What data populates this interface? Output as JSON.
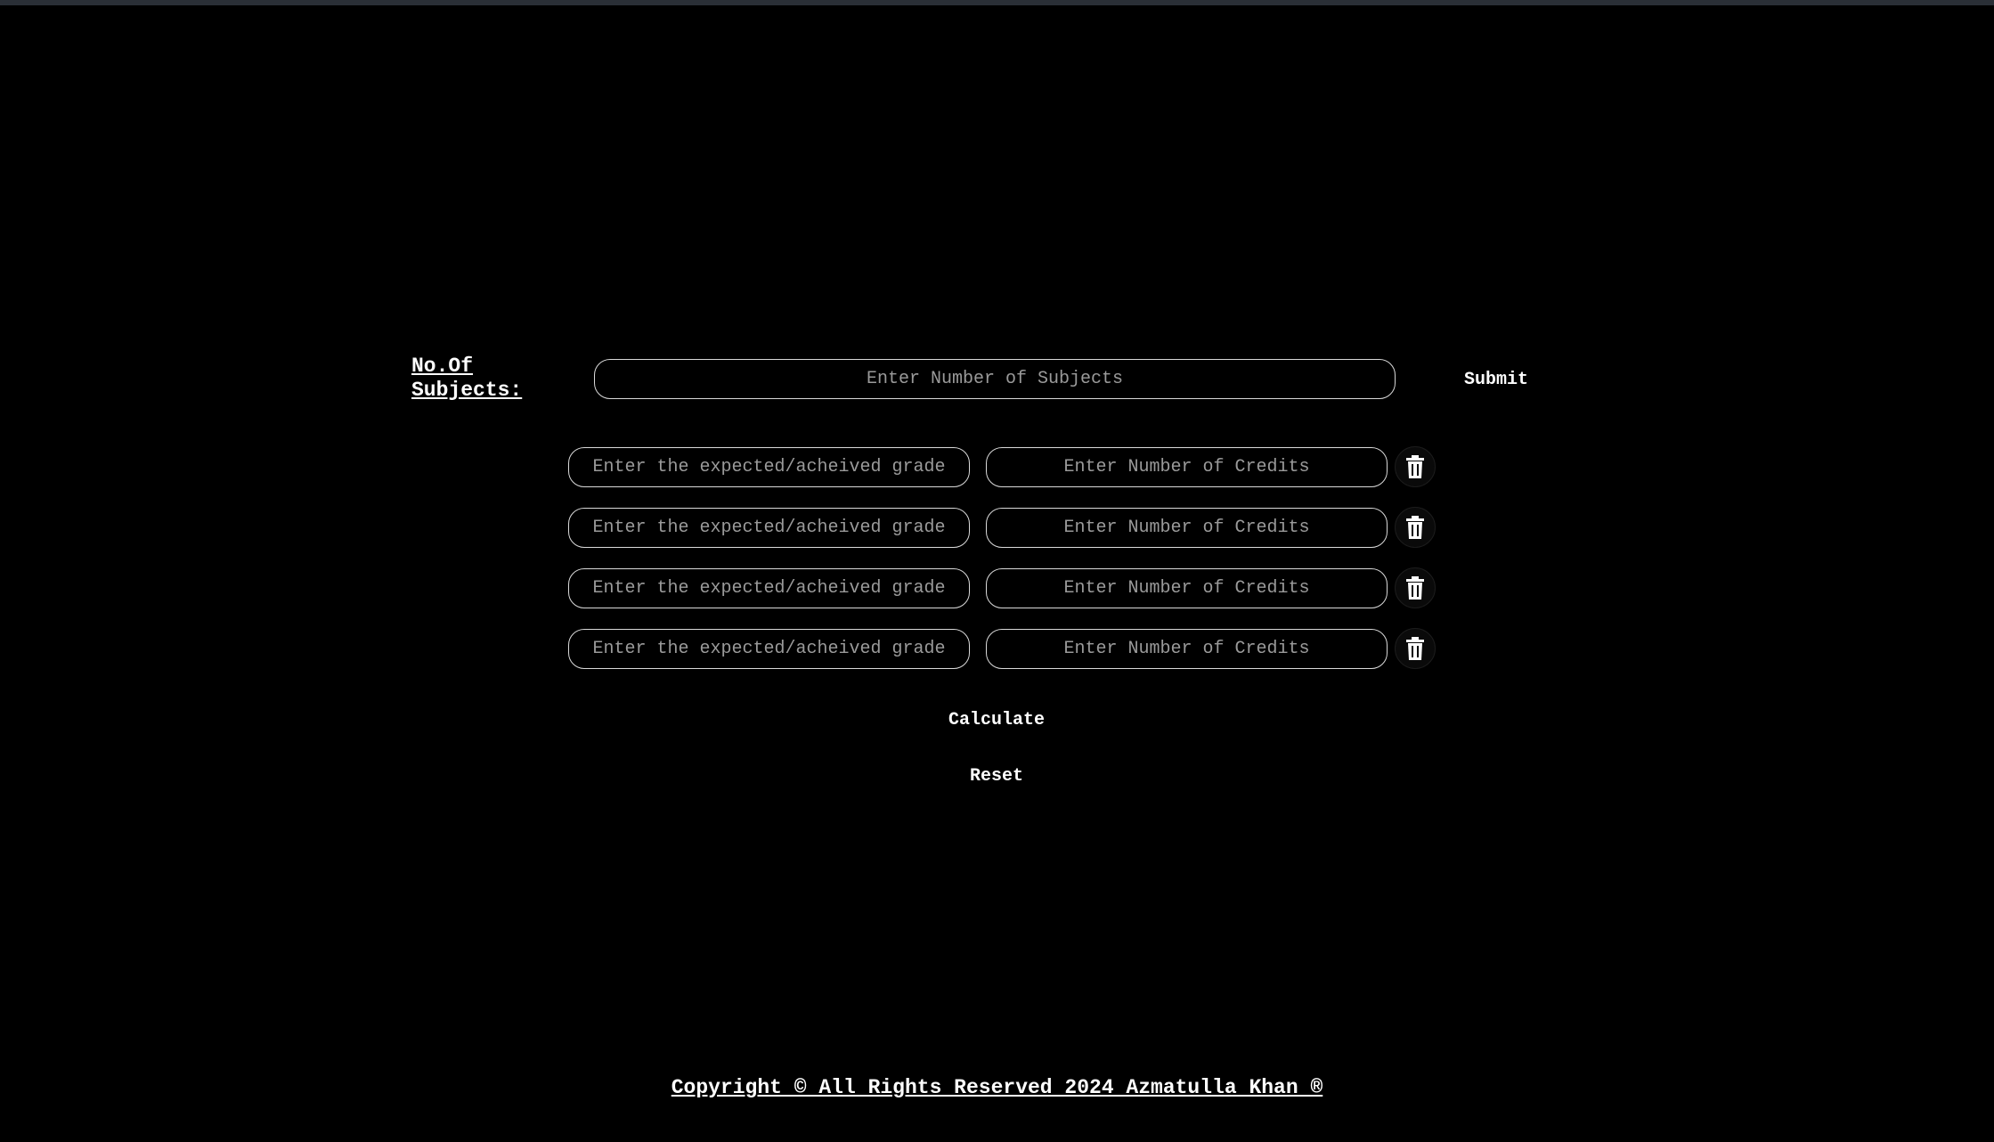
{
  "header": {
    "subjects_label": "No.Of Subjects:",
    "subjects_placeholder": "Enter Number of Subjects",
    "submit_label": "Submit"
  },
  "subject_rows": [
    {
      "grade_placeholder": "Enter the expected/acheived grade",
      "credits_placeholder": "Enter Number of Credits",
      "delete_icon": "trash-icon"
    },
    {
      "grade_placeholder": "Enter the expected/acheived grade",
      "credits_placeholder": "Enter Number of Credits",
      "delete_icon": "trash-icon"
    },
    {
      "grade_placeholder": "Enter the expected/acheived grade",
      "credits_placeholder": "Enter Number of Credits",
      "delete_icon": "trash-icon"
    },
    {
      "grade_placeholder": "Enter the expected/acheived grade",
      "credits_placeholder": "Enter Number of Credits",
      "delete_icon": "trash-icon"
    }
  ],
  "actions": {
    "calculate_label": "Calculate",
    "reset_label": "Reset"
  },
  "footer": {
    "copyright": "Copyright © All Rights Reserved 2024 Azmatulla Khan ®"
  },
  "colors": {
    "background": "#000000",
    "text": "#ffffff",
    "input_border": "#d9d9d9",
    "placeholder": "#9a9a9a"
  }
}
